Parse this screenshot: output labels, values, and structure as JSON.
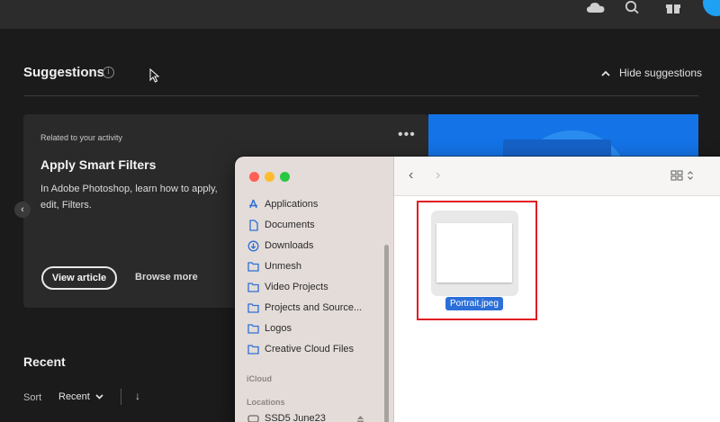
{
  "suggestions": {
    "title": "Suggestions",
    "info_glyph": "i",
    "hide_label": "Hide suggestions"
  },
  "card": {
    "related": "Related to your activity",
    "more_glyph": "•••",
    "title": "Apply Smart Filters",
    "description": "In Adobe Photoshop, learn how to apply, edit, Filters.",
    "view_button": "View article",
    "browse_button": "Browse more",
    "carousel_prev": "‹"
  },
  "recent": {
    "title": "Recent",
    "sort_label": "Sort",
    "sort_value": "Recent",
    "sort_caret": "⌄",
    "sort_direction": "↓"
  },
  "finder": {
    "sidebar": {
      "items": [
        {
          "label": "Applications",
          "icon": "applications-icon"
        },
        {
          "label": "Documents",
          "icon": "document-icon"
        },
        {
          "label": "Downloads",
          "icon": "downloads-icon"
        },
        {
          "label": "Unmesh",
          "icon": "folder-icon"
        },
        {
          "label": "Video Projects",
          "icon": "folder-icon"
        },
        {
          "label": "Projects and Source...",
          "icon": "folder-icon"
        },
        {
          "label": "Logos",
          "icon": "folder-icon"
        },
        {
          "label": "Creative Cloud Files",
          "icon": "folder-icon"
        }
      ],
      "icloud_heading": "iCloud",
      "locations_heading": "Locations",
      "location_item": "SSD5 June23"
    },
    "toolbar": {
      "back_glyph": "‹",
      "forward_glyph": "›",
      "view_mode": "grid-icon"
    },
    "file": {
      "name": "Portrait.jpeg",
      "selected": true
    }
  },
  "colors": {
    "accent_blue": "#1473e6",
    "highlight_red": "#e31b23",
    "finder_selection": "#2c6fd8",
    "traffic_red": "#fe5f57",
    "traffic_yellow": "#febc2e",
    "traffic_green": "#28c840"
  }
}
